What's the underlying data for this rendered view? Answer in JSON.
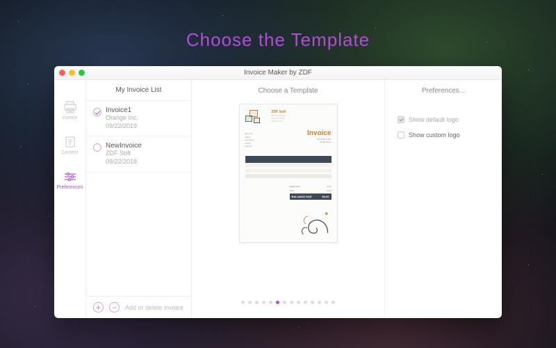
{
  "hero": "Choose  the  Template",
  "window_title": "Invoice Maker by ZDF",
  "rail": {
    "items": [
      {
        "label": "Invoice"
      },
      {
        "label": "Content"
      },
      {
        "label": "Preferences"
      }
    ]
  },
  "list": {
    "heading": "My Invoice List",
    "items": [
      {
        "title": "Invoice1",
        "client": "Orange Inc.",
        "date": "09/22/2019",
        "selected": true
      },
      {
        "title": "NewInvoice",
        "client": "ZDF Soft",
        "date": "09/22/2018",
        "selected": false
      }
    ],
    "footer_label": "Add or delete invoice"
  },
  "center": {
    "heading": "Choose a Template",
    "preview": {
      "company": "ZDF Soft",
      "invoice_word": "Invoice"
    },
    "page_count": 14,
    "active_page_index": 5
  },
  "prefs": {
    "heading": "Preferences...",
    "options": [
      {
        "label": "Show default logo",
        "checked": true,
        "enabled": false
      },
      {
        "label": "Show custom logo",
        "checked": false,
        "enabled": true
      }
    ]
  }
}
